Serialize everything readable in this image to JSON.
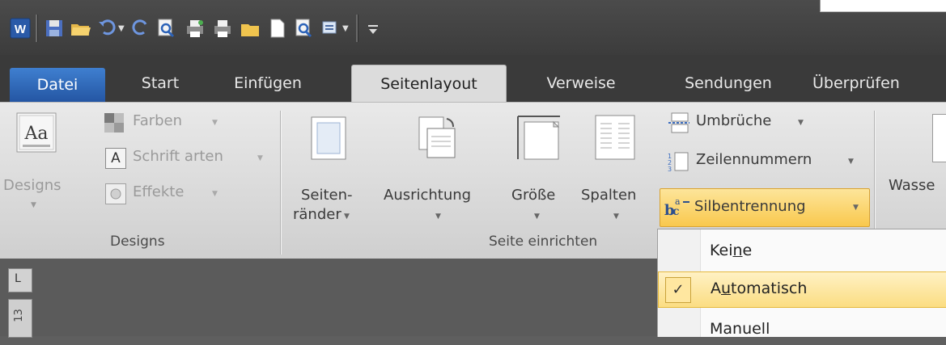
{
  "quick_access": {
    "icons": [
      "word-app-icon",
      "save-icon",
      "open-folder-icon",
      "undo-icon",
      "redo-icon",
      "print-preview-icon",
      "quick-print-icon",
      "print-icon",
      "folder-icon",
      "new-document-icon",
      "preview-icon",
      "customize-icon",
      "overflow-icon"
    ]
  },
  "tabs": [
    "Datei",
    "Start",
    "Einfügen",
    "Seitenlayout",
    "Verweise",
    "Sendungen",
    "Überprüfen"
  ],
  "ribbon": {
    "designs_group": {
      "designs_button": "Designs",
      "farben": "Farben",
      "schriftarten": "Schrift arten",
      "effekte": "Effekte",
      "group_label": "Designs"
    },
    "page_setup_group": {
      "seitenraender_line1": "Seiten-",
      "seitenraender_line2": "ränder",
      "ausrichtung": "Ausrichtung",
      "groesse": "Größe",
      "spalten": "Spalten",
      "umbrueche": "Umbrüche",
      "zeilennummern": "Zeilennummern",
      "silbentrennung": "Silbentrennung",
      "group_label": "Seite einrichten"
    },
    "wasserzeichen_partial": "Wasse"
  },
  "hyphenation_menu": {
    "items": [
      {
        "pre": "Kei",
        "underlined": "n",
        "post": "e"
      },
      {
        "pre": "A",
        "underlined": "u",
        "post": "tomatisch"
      },
      {
        "pre": "Manuell",
        "underlined": "",
        "post": ""
      }
    ]
  },
  "ruler": {
    "corner_glyph": "L",
    "number": "13"
  }
}
